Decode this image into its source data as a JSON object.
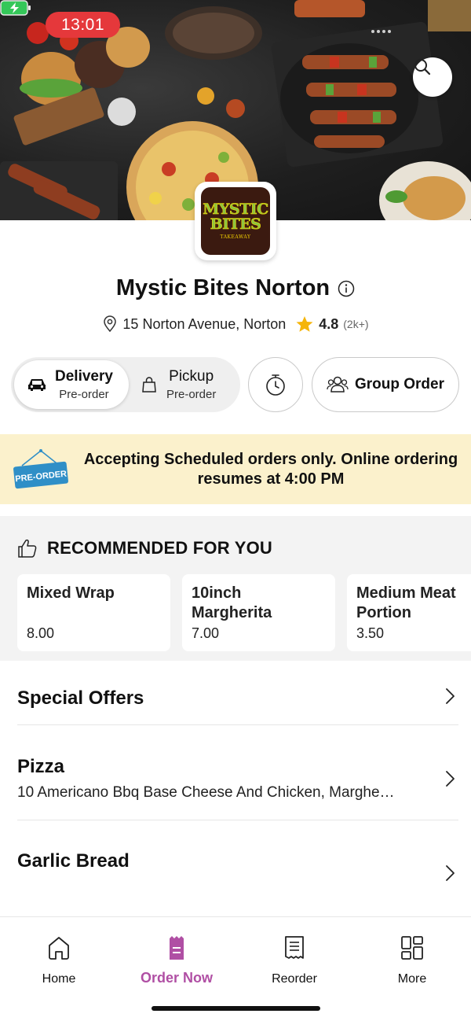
{
  "status_bar": {
    "time": "13:01"
  },
  "store": {
    "name": "Mystic Bites Norton",
    "logo_word_1": "MYSTIC",
    "logo_word_2": "BITES",
    "logo_sub": "TAKEAWAY",
    "address": "15 Norton Avenue, Norton",
    "rating": "4.8",
    "reviews": "(2k+)"
  },
  "order_mode": {
    "delivery_label": "Delivery",
    "delivery_sub": "Pre-order",
    "pickup_label": "Pickup",
    "pickup_sub": "Pre-order",
    "selected": "Delivery"
  },
  "group_order_label": "Group Order",
  "banner": {
    "tag": "PRE-ORDER",
    "message": "Accepting Scheduled orders only. Online ordering resumes at 4:00 PM"
  },
  "recommended": {
    "heading": "RECOMMENDED FOR YOU",
    "items": [
      {
        "name": "Mixed Wrap",
        "price": "8.00"
      },
      {
        "name": "10inch Margherita",
        "price": "7.00"
      },
      {
        "name": "Medium Meat Portion",
        "price": "3.50"
      }
    ]
  },
  "categories": [
    {
      "title": "Special Offers",
      "description": ""
    },
    {
      "title": "Pizza",
      "description": "10 Americano Bbq Base Cheese And Chicken, Marghe…"
    },
    {
      "title": "Garlic Bread",
      "description": ""
    }
  ],
  "bottom_nav": [
    {
      "label": "Home",
      "icon": "home-icon"
    },
    {
      "label": "Order Now",
      "icon": "order-icon",
      "active": true
    },
    {
      "label": "Reorder",
      "icon": "receipt-icon"
    },
    {
      "label": "More",
      "icon": "grid-icon"
    }
  ],
  "colors": {
    "accent": "#b04fa4",
    "banner_bg": "#fbf1cc",
    "star": "#f5b50a",
    "time_pill": "#e5383b",
    "preorder_tag": "#2f8fc7"
  }
}
